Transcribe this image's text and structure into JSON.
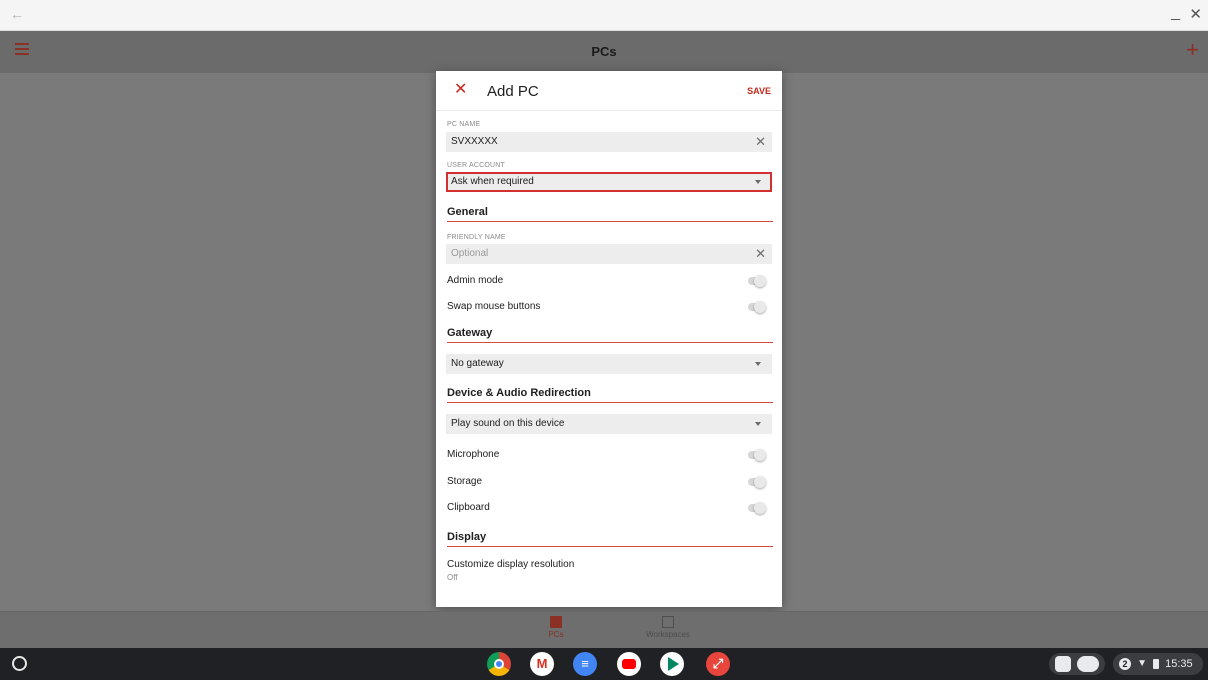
{
  "window": {
    "back_icon": "←",
    "minimize_icon": "_",
    "close_icon": "✕"
  },
  "appbar": {
    "title": "PCs",
    "add_icon": "+"
  },
  "dialog": {
    "close_icon": "✕",
    "title": "Add PC",
    "save_label": "SAVE",
    "pc_name": {
      "label": "PC NAME",
      "value": "SVXXXXX"
    },
    "user_account": {
      "label": "USER ACCOUNT",
      "value": "Ask when required"
    },
    "general": {
      "title": "General",
      "friendly_name": {
        "label": "FRIENDLY NAME",
        "placeholder": "Optional"
      },
      "admin_mode": {
        "label": "Admin mode",
        "on": false
      },
      "swap_mouse": {
        "label": "Swap mouse buttons",
        "on": false
      }
    },
    "gateway": {
      "title": "Gateway",
      "value": "No gateway"
    },
    "device_audio": {
      "title": "Device & Audio Redirection",
      "sound": "Play sound on this device",
      "microphone": {
        "label": "Microphone",
        "on": false
      },
      "storage": {
        "label": "Storage",
        "on": false
      },
      "clipboard": {
        "label": "Clipboard",
        "on": false
      }
    },
    "display": {
      "title": "Display",
      "customize_label": "Customize display resolution",
      "customize_value": "Off"
    }
  },
  "bottom_nav": {
    "pcs": "PCs",
    "workspaces": "Workspaces"
  },
  "shelf": {
    "notification_count": "2",
    "time": "15:35"
  },
  "colors": {
    "accent": "#c4281b",
    "highlight_border": "#d32f2f"
  }
}
